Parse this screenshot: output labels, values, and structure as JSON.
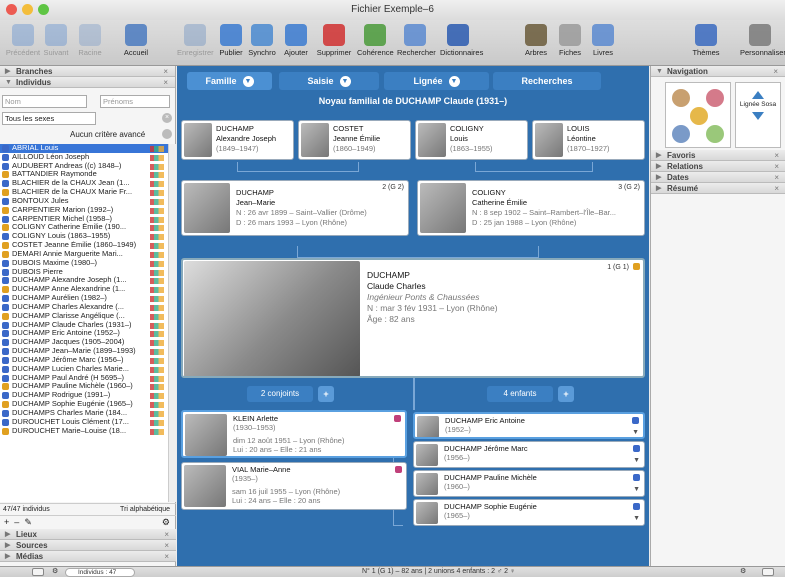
{
  "window": {
    "title": "Fichier Exemple–6"
  },
  "toolbar": {
    "items": [
      "Précédent",
      "Suivant",
      "Racine",
      "Accueil",
      "Enregistrer",
      "Publier",
      "Synchro",
      "Ajouter",
      "Supprimer",
      "Cohérence",
      "Rechercher",
      "Dictionnaires",
      "Arbres",
      "Fiches",
      "Livres",
      "Thèmes",
      "Personnaliser"
    ],
    "disabled": [
      "Précédent",
      "Suivant",
      "Racine",
      "Enregistrer"
    ]
  },
  "left": {
    "sections_top": [
      "Branches",
      "Individus"
    ],
    "nom_placeholder": "Nom",
    "prenoms_placeholder": "Prénoms",
    "sexe_select": "Tous les sexes",
    "criteria": "Aucun critère avancé",
    "people": [
      {
        "name": "ABRIAL Louis",
        "sex": "m"
      },
      {
        "name": "AILLOUD Léon Joseph",
        "sex": "m"
      },
      {
        "name": "AUDUBERT Andreas ((c) 1848–)",
        "sex": "m"
      },
      {
        "name": "BATTANDIER Raymonde",
        "sex": "f"
      },
      {
        "name": "BLACHIER de la CHAUX Jean (1...",
        "sex": "m"
      },
      {
        "name": "BLACHIER de la CHAUX Marie Fr...",
        "sex": "f"
      },
      {
        "name": "BONTOUX Jules",
        "sex": "m"
      },
      {
        "name": "CARPENTIER Marion (1992–)",
        "sex": "f"
      },
      {
        "name": "CARPENTIER Michel (1958–)",
        "sex": "m"
      },
      {
        "name": "COLIGNY Catherine Émilie (190...",
        "sex": "f"
      },
      {
        "name": "COLIGNY Louis (1863–1955)",
        "sex": "m"
      },
      {
        "name": "COSTET Jeanne Émilie (1860–1949)",
        "sex": "f"
      },
      {
        "name": "DEMARI Annie Marguerite Mari...",
        "sex": "f"
      },
      {
        "name": "DUBOIS Maxime (1980–)",
        "sex": "m"
      },
      {
        "name": "DUBOIS Pierre",
        "sex": "m"
      },
      {
        "name": "DUCHAMP Alexandre Joseph (1...",
        "sex": "m"
      },
      {
        "name": "DUCHAMP Anne Alexandrine (1...",
        "sex": "f"
      },
      {
        "name": "DUCHAMP Aurélien (1982–)",
        "sex": "m"
      },
      {
        "name": "DUCHAMP Charles Alexandre (...",
        "sex": "m"
      },
      {
        "name": "DUCHAMP Clarisse Angélique (...",
        "sex": "f"
      },
      {
        "name": "DUCHAMP Claude Charles (1931–)",
        "sex": "m"
      },
      {
        "name": "DUCHAMP Eric Antoine (1952–)",
        "sex": "m"
      },
      {
        "name": "DUCHAMP Jacques (1905–2004)",
        "sex": "m"
      },
      {
        "name": "DUCHAMP Jean–Marie (1899–1993)",
        "sex": "m"
      },
      {
        "name": "DUCHAMP Jérôme Marc (1956–)",
        "sex": "m"
      },
      {
        "name": "DUCHAMP Lucien Charles Marie...",
        "sex": "m"
      },
      {
        "name": "DUCHAMP Paul André (H 5695–)",
        "sex": "m"
      },
      {
        "name": "DUCHAMP Pauline Michèle (1960–)",
        "sex": "f"
      },
      {
        "name": "DUCHAMP Rodrigue (1991–)",
        "sex": "m"
      },
      {
        "name": "DUCHAMP Sophie Eugénie (1965–)",
        "sex": "f"
      },
      {
        "name": "DUCHAMPS Charles Marie (184...",
        "sex": "m"
      },
      {
        "name": "DUROUCHET Louis Clément (17...",
        "sex": "m"
      },
      {
        "name": "DUROUCHET Marie–Louise (18...",
        "sex": "f"
      }
    ],
    "count": "47/47 individus",
    "sort": "Tri alphabétique",
    "sections_bottom": [
      "Lieux",
      "Sources",
      "Médias"
    ]
  },
  "main": {
    "tabs": [
      "Famille",
      "Saisie",
      "Lignée",
      "Recherches"
    ],
    "core_title": "Noyau familial de DUCHAMP Claude (1931–)",
    "grandparents": [
      {
        "l1": "DUCHAMP",
        "l2": "Alexandre Joseph",
        "l3": "(1849–1947)"
      },
      {
        "l1": "COSTET",
        "l2": "Jeanne Émilie",
        "l3": "(1860–1949)"
      },
      {
        "l1": "COLIGNY",
        "l2": "Louis",
        "l3": "(1863–1955)"
      },
      {
        "l1": "LOUIS",
        "l2": "Léontine",
        "l3": "(1870–1927)"
      }
    ],
    "parents": [
      {
        "l1": "DUCHAMP",
        "l2": "Jean–Marie",
        "l3": "N : 26 avr 1899 – Saint–Vallier (Drôme)",
        "l4": "D : 26 mars 1993 – Lyon (Rhône)",
        "gen": "2 (G 2)"
      },
      {
        "l1": "COLIGNY",
        "l2": "Catherine Émilie",
        "l3": "N : 8 sep 1902 – Saint–Rambert–l'Île–Bar...",
        "l4": "D : 25 jan 1988 – Lyon (Rhône)",
        "gen": "3 (G 2)"
      }
    ],
    "root": {
      "l1": "DUCHAMP",
      "l2": "Claude Charles",
      "l3": "Ingénieur Ponts & Chaussées",
      "l4": "N : mar 3 fév 1931 – Lyon (Rhône)",
      "l5": "Âge : 82 ans",
      "gen": "1 (G 1)"
    },
    "spouses_label": "2 conjoints",
    "children_label": "4 enfants",
    "spouses": [
      {
        "l1": "KLEIN Arlette",
        "l2": "(1930–1953)",
        "l3": "dim 12 août 1951 – Lyon (Rhône)",
        "l4": "Lui : 20 ans – Elle : 21 ans"
      },
      {
        "l1": "VIAL Marie–Anne",
        "l2": "(1935–)",
        "l3": "sam 16 juil 1955 – Lyon (Rhône)",
        "l4": "Lui : 24 ans – Elle : 20 ans"
      }
    ],
    "children": [
      {
        "l1": "DUCHAMP Eric Antoine",
        "l2": "(1952–)"
      },
      {
        "l1": "DUCHAMP Jérôme Marc",
        "l2": "(1956–)"
      },
      {
        "l1": "DUCHAMP Pauline Michèle",
        "l2": "(1960–)"
      },
      {
        "l1": "DUCHAMP Sophie Eugénie",
        "l2": "(1965–)"
      }
    ]
  },
  "right": {
    "nav": "Navigation",
    "lignee": "Lignée Sosa",
    "sections": [
      "Favoris",
      "Relations",
      "Dates",
      "Résumé"
    ]
  },
  "status": {
    "individus": "Individus : 47",
    "summary": "N° 1 (G 1) – 82 ans  |  2 unions  4 enfants : 2 ♂ 2 ♀"
  },
  "colors": {
    "male": "#3a68c8",
    "female": "#e0a020",
    "tab": "#3b7fc2",
    "panel": "#2f6fae",
    "selection": "#3875d7"
  }
}
